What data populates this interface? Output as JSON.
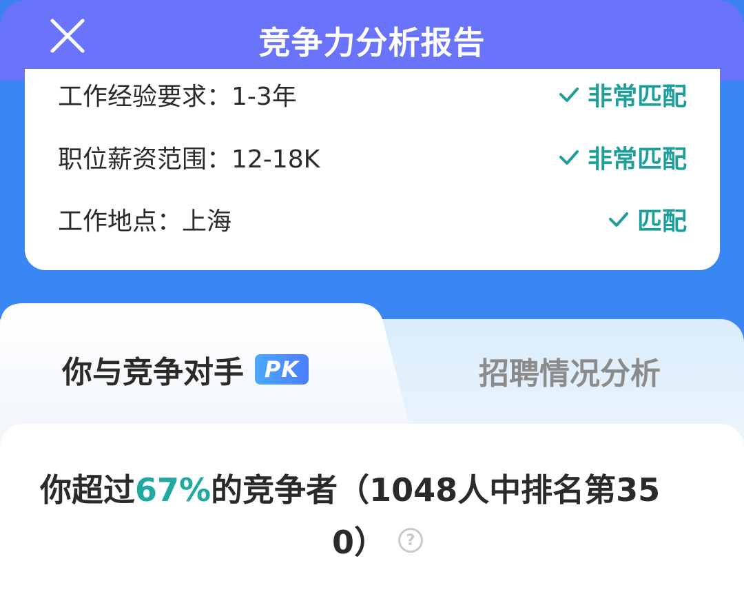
{
  "header": {
    "title": "竞争力分析报告"
  },
  "match": [
    {
      "label": "工作经验要求：1-3年",
      "status": "非常匹配"
    },
    {
      "label": "职位薪资范围：12-18K",
      "status": "非常匹配"
    },
    {
      "label": "工作地点：上海",
      "status": "匹配"
    }
  ],
  "tabs": {
    "left": "你与竞争对手",
    "pk": "PK",
    "right": "招聘情况分析"
  },
  "result": {
    "prefix": "你超过",
    "percent": "67%",
    "middle": "的竞争者（1048人中排名第35",
    "suffix": "0）",
    "help": "?"
  },
  "colors": {
    "header": "#6a74fb",
    "background": "#3a86f2",
    "accent": "#1ea9a3"
  }
}
